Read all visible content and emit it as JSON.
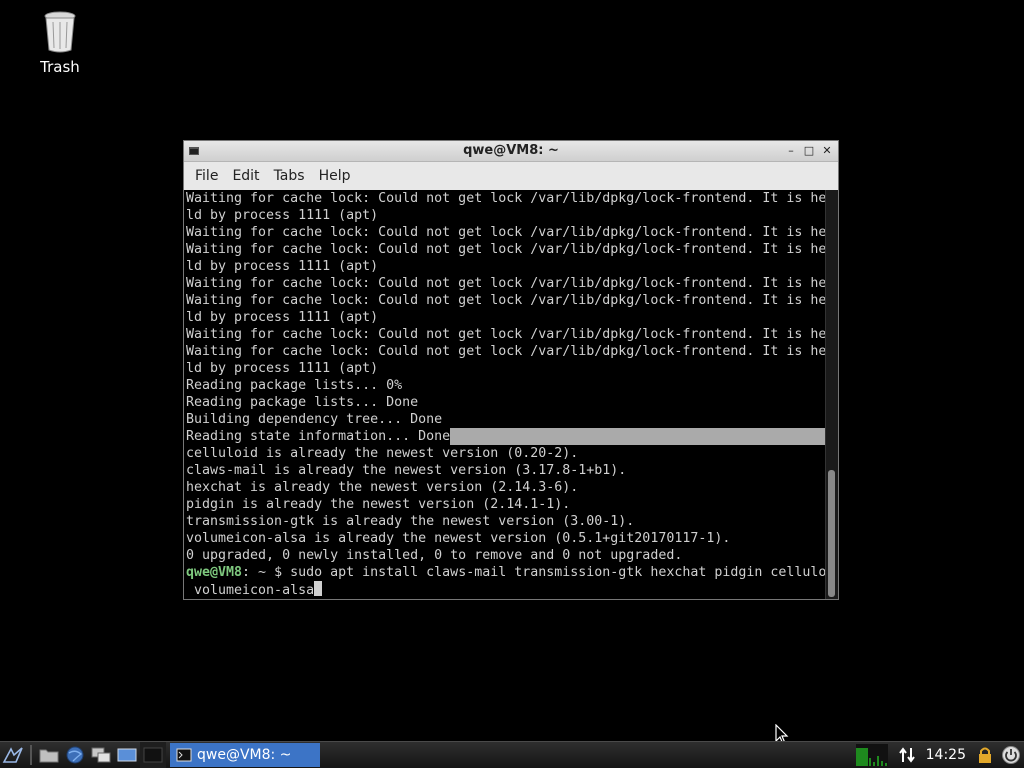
{
  "desktop": {
    "icons": [
      {
        "label": "Trash",
        "icon": "trash-icon"
      }
    ]
  },
  "window": {
    "title": "qwe@VM8: ~",
    "menu": [
      "File",
      "Edit",
      "Tabs",
      "Help"
    ]
  },
  "terminal": {
    "lines": [
      "Waiting for cache lock: Could not get lock /var/lib/dpkg/lock-frontend. It is he",
      "ld by process 1111 (apt)",
      "Waiting for cache lock: Could not get lock /var/lib/dpkg/lock-frontend. It is he",
      "Waiting for cache lock: Could not get lock /var/lib/dpkg/lock-frontend. It is he",
      "ld by process 1111 (apt)",
      "Waiting for cache lock: Could not get lock /var/lib/dpkg/lock-frontend. It is he",
      "Waiting for cache lock: Could not get lock /var/lib/dpkg/lock-frontend. It is he",
      "ld by process 1111 (apt)",
      "Waiting for cache lock: Could not get lock /var/lib/dpkg/lock-frontend. It is he",
      "Waiting for cache lock: Could not get lock /var/lib/dpkg/lock-frontend. It is he",
      "ld by process 1111 (apt)",
      "Reading package lists... 0%",
      "Reading package lists... Done",
      "Building dependency tree... Done",
      "Reading state information... Done",
      "celluloid is already the newest version (0.20-2).",
      "claws-mail is already the newest version (3.17.8-1+b1).",
      "hexchat is already the newest version (2.14.3-6).",
      "pidgin is already the newest version (2.14.1-1).",
      "transmission-gtk is already the newest version (3.00-1).",
      "volumeicon-alsa is already the newest version (0.5.1+git20170117-1).",
      "0 upgraded, 0 newly installed, 0 to remove and 0 not upgraded."
    ],
    "prompt_user": "qwe@VM8",
    "prompt_rest": ": ~ $ sudo apt install claws-mail transmission-gtk hexchat pidgin celluloid",
    "last_line": " volumeicon-alsa"
  },
  "taskbar": {
    "launchers": [
      "menu-icon",
      "file-manager-icon",
      "browser-icon",
      "window-switcher-icon",
      "show-desktop-icon",
      "terminal-launcher-icon"
    ],
    "task_label": "qwe@VM8: ~",
    "clock": "14:25",
    "tray_icons": [
      "cpu-monitor-icon",
      "network-icon",
      "lock-icon",
      "power-icon"
    ]
  }
}
